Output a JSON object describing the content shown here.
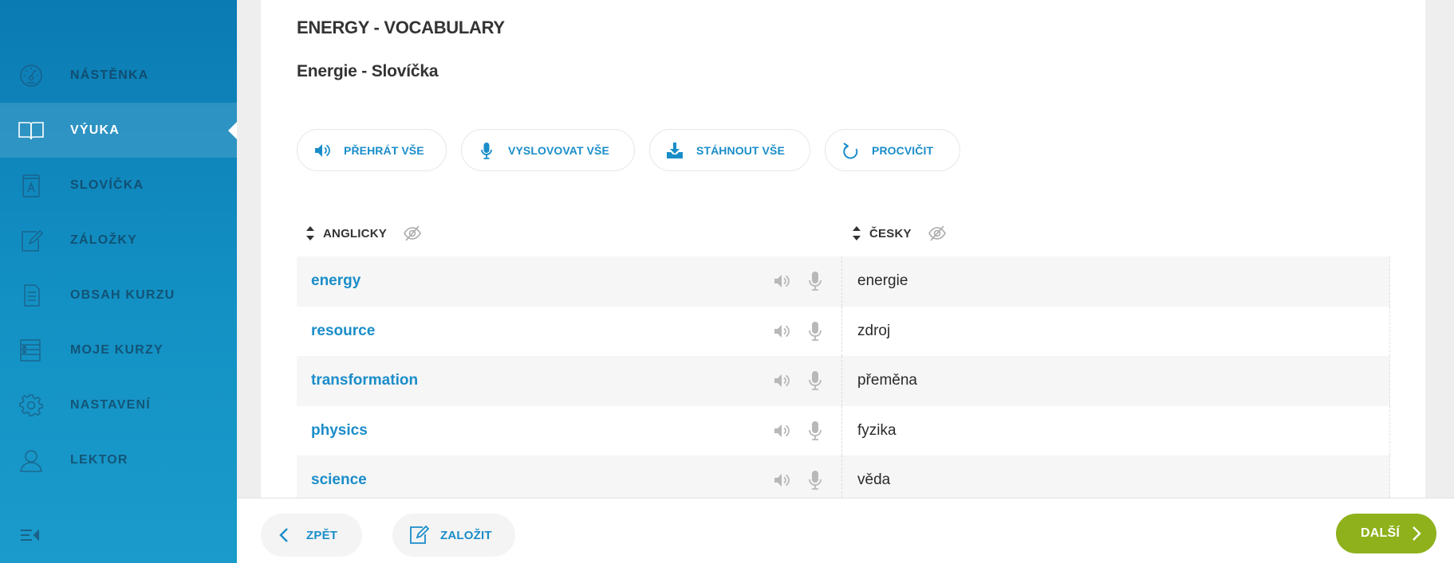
{
  "sidebar": {
    "items": [
      {
        "label": "NÁSTĚNKA",
        "icon": "dashboard-gauge-icon"
      },
      {
        "label": "VÝUKA",
        "icon": "open-book-icon",
        "active": true
      },
      {
        "label": "SLOVÍČKA",
        "icon": "dictionary-icon"
      },
      {
        "label": "ZÁLOŽKY",
        "icon": "bookmark-edit-icon"
      },
      {
        "label": "OBSAH KURZU",
        "icon": "document-list-icon"
      },
      {
        "label": "MOJE KURZY",
        "icon": "course-list-icon"
      },
      {
        "label": "NASTAVENÍ",
        "icon": "gear-icon"
      },
      {
        "label": "LEKTOR",
        "icon": "person-icon"
      }
    ],
    "collapse_icon": "collapse-menu-icon"
  },
  "lesson": {
    "title_en": "ENERGY - VOCABULARY",
    "title_cs": "Energie - Slovíčka"
  },
  "actions": {
    "play_all": "PŘEHRÁT VŠE",
    "pronounce_all": "VYSLOVOVAT VŠE",
    "download_all": "STÁHNOUT VŠE",
    "practice": "PROCVIČIT"
  },
  "table": {
    "col_en": "ANGLICKY",
    "col_cs": "ČESKY",
    "rows": [
      {
        "en": "energy",
        "cs": "energie"
      },
      {
        "en": "resource",
        "cs": "zdroj"
      },
      {
        "en": "transformation",
        "cs": "přeměna"
      },
      {
        "en": "physics",
        "cs": "fyzika"
      },
      {
        "en": "science",
        "cs": "věda"
      }
    ]
  },
  "footer": {
    "back": "ZPĚT",
    "bookmark": "ZALOŽIT",
    "next": "DALŠÍ"
  },
  "colors": {
    "accent": "#1a8dc9",
    "sidebar": "#0b7bb3",
    "next_button": "#8fb11b"
  }
}
